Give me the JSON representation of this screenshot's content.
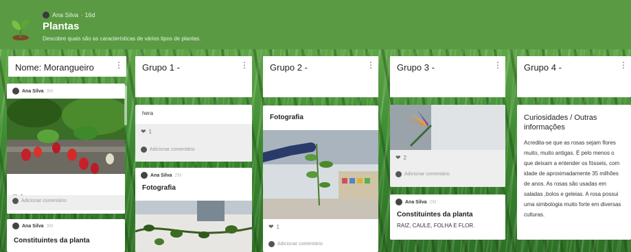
{
  "header": {
    "author": "Ana Silva",
    "age": "· 16d",
    "title": "Plantas",
    "description": "Descobre quais são as características de vários tipos de plantas.",
    "color": "#5a9a43"
  },
  "columns": [
    {
      "title": "Nome: Morangueiro",
      "menu": "⋮"
    },
    {
      "title": "Grupo 1 -",
      "menu": "⋮"
    },
    {
      "title": "Grupo 2 -",
      "menu": "⋮"
    },
    {
      "title": "Grupo 3 -",
      "menu": "⋮"
    },
    {
      "title": "Grupo 4 -",
      "menu": "⋮"
    }
  ],
  "col1": {
    "card1": {
      "author": "Ana Silva",
      "time": "3M",
      "likes": "2",
      "comment": "Adicionar comentário"
    },
    "card2": {
      "author": "Ana Silva",
      "time": "3M",
      "title": "Constituintes da planta"
    }
  },
  "col2": {
    "card1": {
      "text": "hera",
      "likes": "1",
      "comment": "Adicionar comentário"
    },
    "card2": {
      "author": "Ana Silva",
      "time": "2M",
      "title": "Fotografia"
    }
  },
  "col3": {
    "card1": {
      "title": "Fotografia",
      "likes": "1",
      "comment": "Adicionar comentário"
    }
  },
  "col4": {
    "card1": {
      "likes": "2",
      "comment": "Adicionar comentário"
    },
    "card2": {
      "author": "Ana Silva",
      "time": "2M",
      "title": "Constituintes da planta",
      "text": "RAIZ, CAULE, FOLHA E FLOR."
    }
  },
  "col5": {
    "card1": {
      "title": "Curiosidades / Outras informações",
      "body": "Acredita-se que as rosas sejam flores muito, muito antigas. É pelo menos o que deixam a entender os fósseis, com idade de aproximadamente 35 milhões de anos. As rosas são usadas em saladas ,bolos e geleias. A rosa possui uma simbologia muito forte em diversas culturas."
    }
  }
}
